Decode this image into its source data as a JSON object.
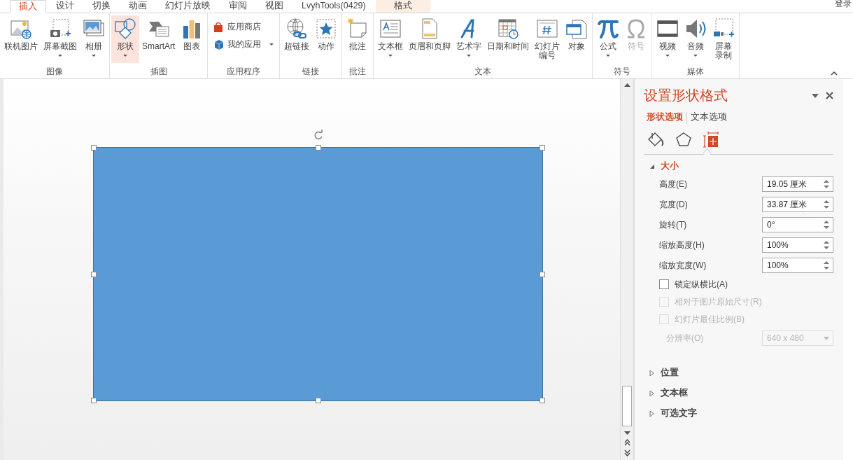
{
  "tabs": [
    {
      "label": "插入",
      "selected": true,
      "contextual": false
    },
    {
      "label": "设计",
      "selected": false,
      "contextual": false
    },
    {
      "label": "切换",
      "selected": false,
      "contextual": false
    },
    {
      "label": "动画",
      "selected": false,
      "contextual": false
    },
    {
      "label": "幻灯片放映",
      "selected": false,
      "contextual": false
    },
    {
      "label": "审阅",
      "selected": false,
      "contextual": false
    },
    {
      "label": "视图",
      "selected": false,
      "contextual": false
    },
    {
      "label": "LvyhTools(0429)",
      "selected": false,
      "contextual": false
    },
    {
      "label": "格式",
      "selected": false,
      "contextual": true
    }
  ],
  "account": "登录",
  "ribbon": {
    "groups": [
      {
        "label": "图像",
        "items": [
          {
            "kind": "large",
            "label": "联机图片",
            "dropdown": false,
            "selected": false,
            "disabled": false
          },
          {
            "kind": "large",
            "label": "屏幕截图",
            "dropdown": true,
            "selected": false,
            "disabled": false
          },
          {
            "kind": "large",
            "label": "相册",
            "dropdown": true,
            "selected": false,
            "disabled": false
          }
        ]
      },
      {
        "label": "插图",
        "items": [
          {
            "kind": "large",
            "label": "形状",
            "dropdown": true,
            "selected": true,
            "disabled": false
          },
          {
            "kind": "large",
            "label": "SmartArt",
            "dropdown": false,
            "selected": false,
            "disabled": false
          },
          {
            "kind": "large",
            "label": "图表",
            "dropdown": false,
            "selected": false,
            "disabled": false
          }
        ]
      },
      {
        "label": "应用程序",
        "items": [
          {
            "kind": "small",
            "label": "应用商店",
            "dropdown": false,
            "selected": false,
            "disabled": false
          },
          {
            "kind": "small",
            "label": "我的应用",
            "dropdown": true,
            "selected": false,
            "disabled": false
          }
        ]
      },
      {
        "label": "链接",
        "items": [
          {
            "kind": "large",
            "label": "超链接",
            "dropdown": false,
            "selected": false,
            "disabled": false
          },
          {
            "kind": "large",
            "label": "动作",
            "dropdown": false,
            "selected": false,
            "disabled": false
          }
        ]
      },
      {
        "label": "批注",
        "items": [
          {
            "kind": "large",
            "label": "批注",
            "dropdown": false,
            "selected": false,
            "disabled": false
          }
        ]
      },
      {
        "label": "文本",
        "items": [
          {
            "kind": "large",
            "label": "文本框",
            "dropdown": true,
            "selected": false,
            "disabled": false
          },
          {
            "kind": "large",
            "label": "页眉和页脚",
            "dropdown": false,
            "selected": false,
            "disabled": false
          },
          {
            "kind": "large",
            "label": "艺术字",
            "dropdown": true,
            "selected": false,
            "disabled": false
          },
          {
            "kind": "large",
            "label": "日期和时间",
            "dropdown": false,
            "selected": false,
            "disabled": false
          },
          {
            "kind": "large",
            "label": "幻灯片",
            "label_2": "编号",
            "selected": false,
            "disabled": false
          },
          {
            "kind": "large",
            "label": "对象",
            "dropdown": false,
            "selected": false,
            "disabled": false
          }
        ]
      },
      {
        "label": "符号",
        "items": [
          {
            "kind": "large",
            "label": "公式",
            "dropdown": true,
            "selected": false,
            "disabled": false
          },
          {
            "kind": "large",
            "label": "符号",
            "dropdown": false,
            "selected": false,
            "disabled": true
          }
        ]
      },
      {
        "label": "媒体",
        "items": [
          {
            "kind": "large",
            "label": "视频",
            "dropdown": true,
            "selected": false,
            "disabled": false
          },
          {
            "kind": "large",
            "label": "音频",
            "dropdown": true,
            "selected": false,
            "disabled": false
          },
          {
            "kind": "large",
            "label": "屏幕",
            "label_2": "录制",
            "selected": false,
            "disabled": false
          }
        ]
      }
    ]
  },
  "panel": {
    "title": "设置形状格式",
    "tabs": [
      {
        "label": "形状选项",
        "selected": true
      },
      {
        "label": "文本选项",
        "selected": false
      }
    ],
    "icon_tabs": [
      {
        "selected": false
      },
      {
        "selected": false
      },
      {
        "selected": true
      }
    ],
    "sections": [
      {
        "label": "大小",
        "expanded": true,
        "rows": [
          {
            "kind": "spinner",
            "label": "高度(E)",
            "value": "19.05 厘米",
            "disabled": false
          },
          {
            "kind": "spinner",
            "label": "宽度(D)",
            "value": "33.87 厘米",
            "disabled": false
          },
          {
            "kind": "spinner",
            "label": "旋转(T)",
            "value": "0°",
            "disabled": false
          },
          {
            "kind": "spinner",
            "label": "缩放高度(H)",
            "value": "100%",
            "disabled": false
          },
          {
            "kind": "spinner",
            "label": "缩放宽度(W)",
            "value": "100%",
            "disabled": false
          },
          {
            "kind": "checkbox",
            "label": "锁定纵横比(A)",
            "checked": false,
            "disabled": false
          },
          {
            "kind": "checkbox",
            "label": "相对于图片原始尺寸(R)",
            "checked": false,
            "disabled": true
          },
          {
            "kind": "checkbox",
            "label": "幻灯片最佳比例(B)",
            "checked": false,
            "disabled": true
          },
          {
            "kind": "dropdown",
            "label": "分辨率(O)",
            "value": "640 x 480",
            "disabled": true
          }
        ]
      },
      {
        "label": "位置",
        "expanded": false
      },
      {
        "label": "文本框",
        "expanded": false
      },
      {
        "label": "可选文字",
        "expanded": false
      }
    ]
  }
}
